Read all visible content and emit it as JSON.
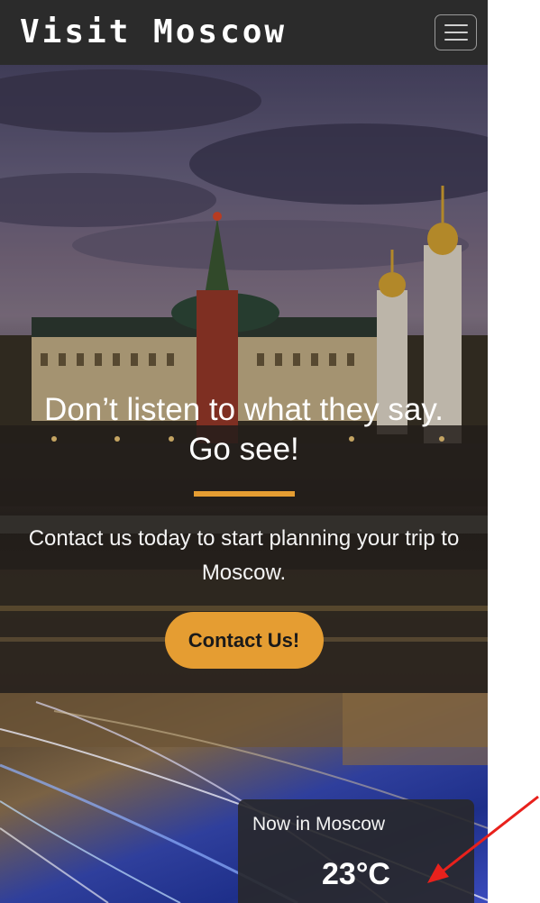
{
  "navbar": {
    "brand": "Visit Moscow",
    "menu_icon": "hamburger-menu-icon"
  },
  "hero": {
    "title_line1": "Don’t listen to what they say.",
    "title_line2": "Go see!",
    "subtitle": "Contact us today to start planning your trip to Moscow.",
    "cta_label": "Contact Us!"
  },
  "weather": {
    "label": "Now in Moscow",
    "temperature": "23°C"
  },
  "colors": {
    "navbar_bg": "#2b2b2b",
    "accent": "#e59d32",
    "annotation_arrow": "#e8211c"
  }
}
